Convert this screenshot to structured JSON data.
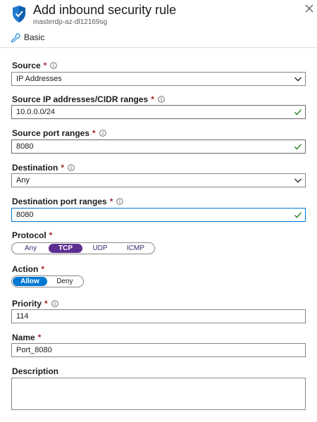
{
  "header": {
    "title": "Add inbound security rule",
    "subtitle": "masterdp-az-dl12169sg"
  },
  "tab": {
    "label": "Basic"
  },
  "form": {
    "required_marker": "*",
    "source": {
      "label": "Source",
      "value": "IP Addresses"
    },
    "source_ip": {
      "label": "Source IP addresses/CIDR ranges",
      "value": "10.0.0.0/24"
    },
    "source_port": {
      "label": "Source port ranges",
      "value": "8080"
    },
    "destination": {
      "label": "Destination",
      "value": "Any"
    },
    "destination_port": {
      "label": "Destination port ranges",
      "value": "8080"
    },
    "protocol": {
      "label": "Protocol",
      "options": [
        "Any",
        "TCP",
        "UDP",
        "ICMP"
      ],
      "selected": "TCP"
    },
    "action": {
      "label": "Action",
      "options": [
        "Allow",
        "Deny"
      ],
      "selected": "Allow"
    },
    "priority": {
      "label": "Priority",
      "value": "114"
    },
    "name": {
      "label": "Name",
      "value": "Port_8080"
    },
    "description": {
      "label": "Description",
      "value": ""
    }
  },
  "colors": {
    "required": "#a4262c",
    "valid_check": "#107c10",
    "protocol_selected": "#5c2e91",
    "action_selected": "#0078d4",
    "focus_border": "#0078d4"
  },
  "icons": {
    "header": "shield-icon",
    "close": "close-icon",
    "tab": "wrench-icon",
    "info": "info-icon",
    "dropdown": "chevron-down-icon",
    "valid": "checkmark-icon"
  }
}
